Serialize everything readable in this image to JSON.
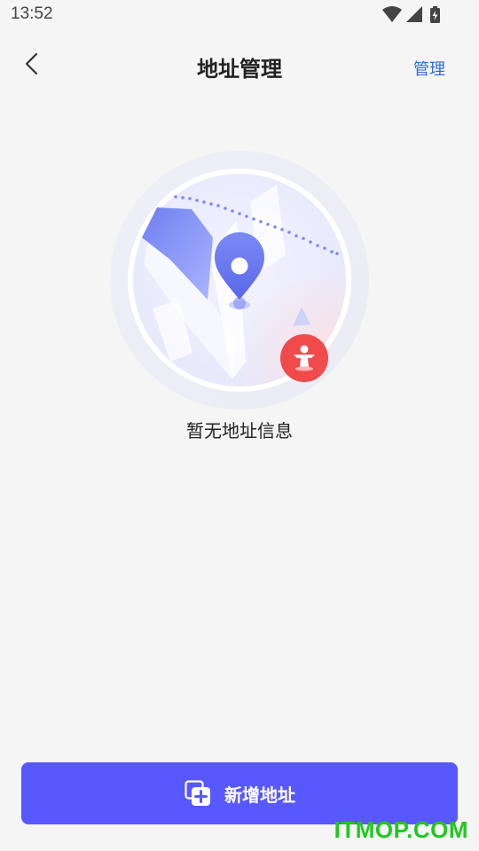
{
  "status_bar": {
    "time": "13:52",
    "icons": [
      "wifi-icon",
      "cellular-signal-icon",
      "battery-charging-icon"
    ]
  },
  "header": {
    "back_icon": "chevron-left-icon",
    "title": "地址管理",
    "manage_label": "管理"
  },
  "empty_state": {
    "illustration": "map-location-illustration",
    "message": "暂无地址信息"
  },
  "add_button": {
    "icon": "add-copy-icon",
    "label": "新增地址"
  },
  "watermark": "ITMOP.COM",
  "colors": {
    "accent": "#5858ff",
    "link": "#2f6ad9",
    "background": "#f5f5f5",
    "pin": "#6c78f0",
    "badge": "#f04a4a",
    "watermark": "#1fc81f"
  }
}
